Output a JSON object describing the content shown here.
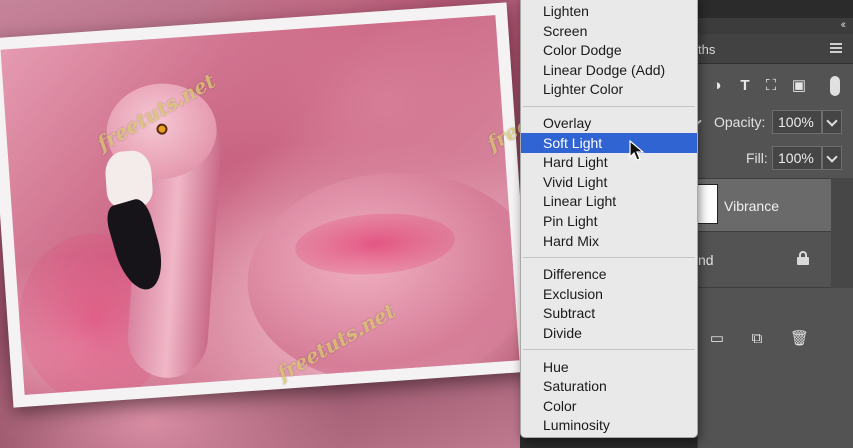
{
  "watermark_text": "freetuts.net",
  "blend_menu": {
    "groups": [
      {
        "items": [
          {
            "label": "Lighten"
          },
          {
            "label": "Screen"
          },
          {
            "label": "Color Dodge"
          },
          {
            "label": "Linear Dodge (Add)"
          },
          {
            "label": "Lighter Color"
          }
        ]
      },
      {
        "items": [
          {
            "label": "Overlay"
          },
          {
            "label": "Soft Light",
            "selected": true
          },
          {
            "label": "Hard Light"
          },
          {
            "label": "Vivid Light"
          },
          {
            "label": "Linear Light"
          },
          {
            "label": "Pin Light"
          },
          {
            "label": "Hard Mix"
          }
        ]
      },
      {
        "items": [
          {
            "label": "Difference"
          },
          {
            "label": "Exclusion"
          },
          {
            "label": "Subtract"
          },
          {
            "label": "Divide"
          }
        ]
      },
      {
        "items": [
          {
            "label": "Hue"
          },
          {
            "label": "Saturation"
          },
          {
            "label": "Color"
          },
          {
            "label": "Luminosity"
          }
        ]
      }
    ],
    "selected_color": "#2f64d2"
  },
  "panel": {
    "collapse_glyph": "‹‹",
    "tab_partial": "ths",
    "opacity_label": "Opacity:",
    "opacity_value": "100%",
    "fill_label": "Fill:",
    "fill_value": "100%",
    "layers": {
      "vibrance_label": "Vibrance",
      "background_label_partial": "nd"
    },
    "filter_icons": [
      "adjustment-filter-icon",
      "type-filter-icon",
      "shape-filter-icon",
      "smart-object-filter-icon",
      "filter-toggle-icon"
    ],
    "bottom_icons": [
      "new-group-icon",
      "new-layer-icon",
      "delete-layer-icon"
    ]
  }
}
